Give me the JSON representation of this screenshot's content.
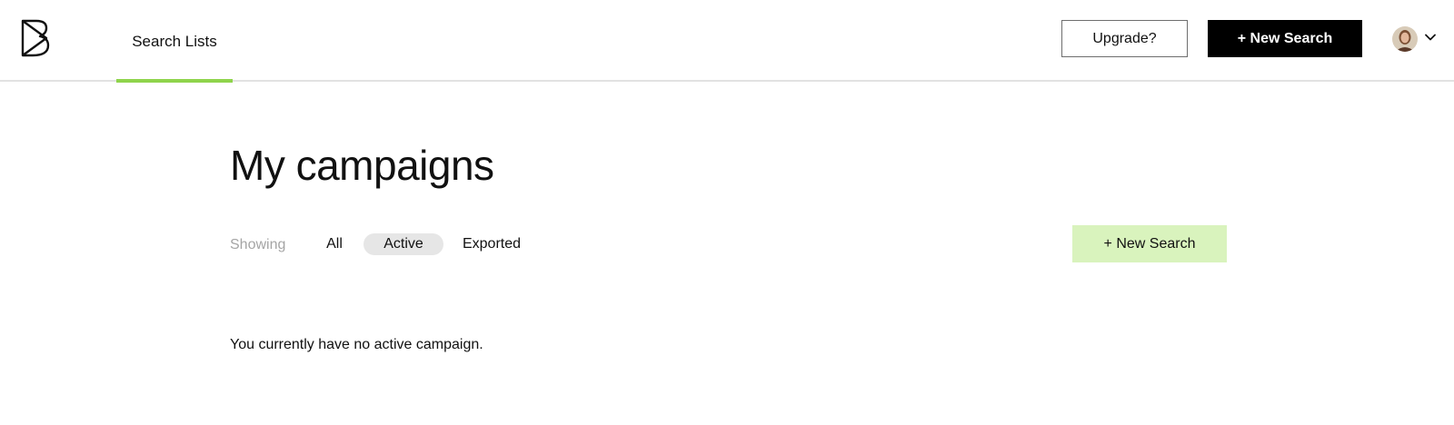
{
  "header": {
    "logo_icon": "b-play-logo-icon",
    "nav_tab_label": "Search Lists",
    "active_tab_color": "#8fd44c",
    "upgrade_label": "Upgrade?",
    "new_search_label": "+ New Search",
    "avatar_icon": "user-avatar",
    "menu_icon": "chevron-down-icon"
  },
  "main": {
    "title": "My campaigns",
    "showing_label": "Showing",
    "filters": [
      {
        "label": "All",
        "selected": false
      },
      {
        "label": "Active",
        "selected": true
      },
      {
        "label": "Exported",
        "selected": false
      }
    ],
    "new_search_label": "+ New Search",
    "new_search_color": "#d9f3bd",
    "empty_message": "You currently have no active campaign."
  }
}
